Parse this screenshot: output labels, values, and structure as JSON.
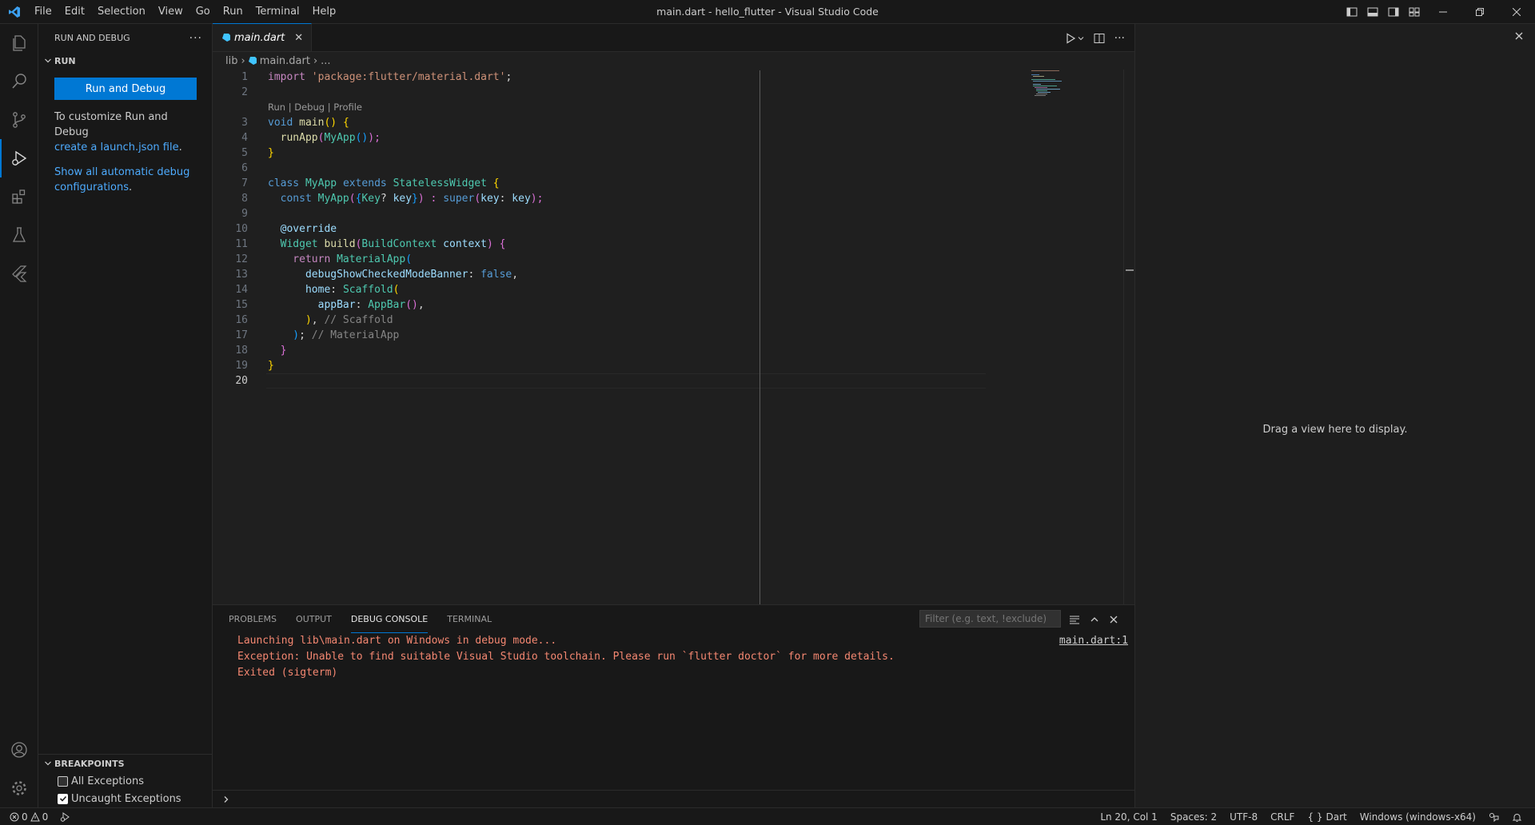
{
  "window": {
    "title": "main.dart - hello_flutter - Visual Studio Code"
  },
  "menu": [
    "File",
    "Edit",
    "Selection",
    "View",
    "Go",
    "Run",
    "Terminal",
    "Help"
  ],
  "sidebar": {
    "title": "RUN AND DEBUG",
    "section": "RUN",
    "run_button": "Run and Debug",
    "customize_text": "To customize Run and Debug",
    "launch_link": "create a launch.json file",
    "period": ".",
    "auto_link_1": "Show all automatic debug",
    "auto_link_2": "configurations",
    "breakpoints": {
      "title": "BREAKPOINTS",
      "items": [
        {
          "label": "All Exceptions",
          "checked": false
        },
        {
          "label": "Uncaught Exceptions",
          "checked": true
        }
      ]
    }
  },
  "editor": {
    "tab": "main.dart",
    "breadcrumb": {
      "folder": "lib",
      "file": "main.dart",
      "more": "..."
    },
    "codelens": "Run | Debug | Profile",
    "line_numbers": [
      "1",
      "2",
      "3",
      "4",
      "5",
      "6",
      "7",
      "8",
      "9",
      "10",
      "11",
      "12",
      "13",
      "14",
      "15",
      "16",
      "17",
      "18",
      "19",
      "20"
    ],
    "lines": {
      "l1a": "import ",
      "l1b": "'package:flutter/material.dart'",
      "l1c": ";",
      "l3a": "void ",
      "l3b": "main",
      "l3c": "() ",
      "l3d": "{",
      "l4a": "  runApp",
      "l4b": "(",
      "l4c": "MyApp",
      "l4d": "()",
      "l4e": ");",
      "l5a": "}",
      "l7a": "class ",
      "l7b": "MyApp ",
      "l7c": "extends ",
      "l7d": "StatelessWidget ",
      "l7e": "{",
      "l8a": "  const ",
      "l8b": "MyApp",
      "l8c": "(",
      "l8d": "{",
      "l8e": "Key",
      "l8f": "? ",
      "l8g": "key",
      "l8h": "}",
      "l8i": ") : ",
      "l8j": "super",
      "l8k": "(",
      "l8l": "key",
      "l8m": ": ",
      "l8n": "key",
      "l8o": ");",
      "l10a": "  @override",
      "l11a": "  Widget ",
      "l11b": "build",
      "l11c": "(",
      "l11d": "BuildContext ",
      "l11e": "context",
      "l11f": ") ",
      "l11g": "{",
      "l12a": "    return ",
      "l12b": "MaterialApp",
      "l12c": "(",
      "l13a": "      debugShowCheckedModeBanner",
      "l13b": ": ",
      "l13c": "false",
      "l13d": ",",
      "l14a": "      home",
      "l14b": ": ",
      "l14c": "Scaffold",
      "l14d": "(",
      "l15a": "        appBar",
      "l15b": ": ",
      "l15c": "AppBar",
      "l15d": "()",
      "l15e": ",",
      "l16a": "      )",
      "l16b": ", ",
      "l16c": "// Scaffold",
      "l17a": "    )",
      "l17b": "; ",
      "l17c": "// MaterialApp",
      "l18a": "  }",
      "l19a": "}"
    }
  },
  "panel": {
    "tabs": [
      "PROBLEMS",
      "OUTPUT",
      "DEBUG CONSOLE",
      "TERMINAL"
    ],
    "active_tab": "DEBUG CONSOLE",
    "filter_placeholder": "Filter (e.g. text, !exclude)",
    "source_link": "main.dart:1",
    "console_lines": [
      "Launching lib\\main.dart on Windows in debug mode...",
      "Exception: Unable to find suitable Visual Studio toolchain. Please run `flutter doctor` for more details.",
      "Exited (sigterm)"
    ]
  },
  "aux": {
    "empty_text": "Drag a view here to display."
  },
  "statusbar": {
    "errors": "0",
    "warnings": "0",
    "position": "Ln 20, Col 1",
    "spaces": "Spaces: 2",
    "encoding": "UTF-8",
    "eol": "CRLF",
    "language": "Dart",
    "device": "Windows (windows-x64)"
  },
  "colors": {
    "accent": "#0078d4",
    "error_text": "#f48771",
    "link": "#4daafc"
  }
}
